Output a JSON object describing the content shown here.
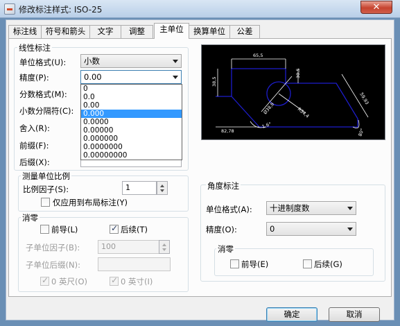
{
  "window": {
    "title": "修改标注样式: ISO-25",
    "close": "✕"
  },
  "tabs": [
    {
      "label": "标注线"
    },
    {
      "label": "符号和箭头"
    },
    {
      "label": "文字"
    },
    {
      "label": "调整"
    },
    {
      "label": "主单位",
      "active": true
    },
    {
      "label": "换算单位"
    },
    {
      "label": "公差"
    }
  ],
  "linear": {
    "title": "线性标注",
    "unit_format_label": "单位格式(U):",
    "unit_format_value": "小数",
    "precision_label": "精度(P):",
    "precision_value": "0.00",
    "fraction_format_label": "分数格式(M):",
    "decimal_sep_label": "小数分隔符(C):",
    "round_off_label": "舍入(R):",
    "prefix_label": "前缀(F):",
    "suffix_label": "后缀(X):",
    "precision_options": [
      "0",
      "0.0",
      "0.00",
      "0.000",
      "0.0000",
      "0.00000",
      "0.000000",
      "0.0000000",
      "0.00000000"
    ],
    "precision_selected_index": 3
  },
  "scale": {
    "title": "测量单位比例",
    "factor_label": "比例因子(S):",
    "factor_value": "1",
    "layout_only_label": "仅应用到布局标注(Y)",
    "layout_only_checked": false
  },
  "zero_suppress": {
    "title": "消零",
    "leading_label": "前导(L)",
    "leading_checked": false,
    "trailing_label": "后续(T)",
    "trailing_checked": true,
    "subunit_factor_label": "子单位因子(B):",
    "subunit_factor_value": "100",
    "subunit_suffix_label": "子单位后缀(N):",
    "subunit_suffix_value": "",
    "feet_label": "0 英尺(O)",
    "feet_checked": true,
    "inch_label": "0 英寸(I)",
    "inch_checked": true
  },
  "angular": {
    "title": "角度标注",
    "unit_format_label": "单位格式(A):",
    "unit_format_value": "十进制度数",
    "precision_label": "精度(O):",
    "precision_value": "0",
    "zero_title": "消零",
    "leading_label": "前导(E)",
    "leading_checked": false,
    "trailing_label": "后续(G)",
    "trailing_checked": false
  },
  "preview": {
    "dims": [
      "65,5",
      "30,5",
      "38,5",
      "59,93",
      "82,78",
      "R34,4",
      "Ø38,8",
      "1,6°",
      "80°"
    ],
    "line_color": "#1d1dcc",
    "text_color": "#ffffff"
  },
  "buttons": {
    "ok": "确定",
    "cancel": "取消"
  },
  "colors": {
    "selection": "#3399ff",
    "window_frame": "#6a8fb5",
    "dialog_bg": "#f0f0f0"
  }
}
